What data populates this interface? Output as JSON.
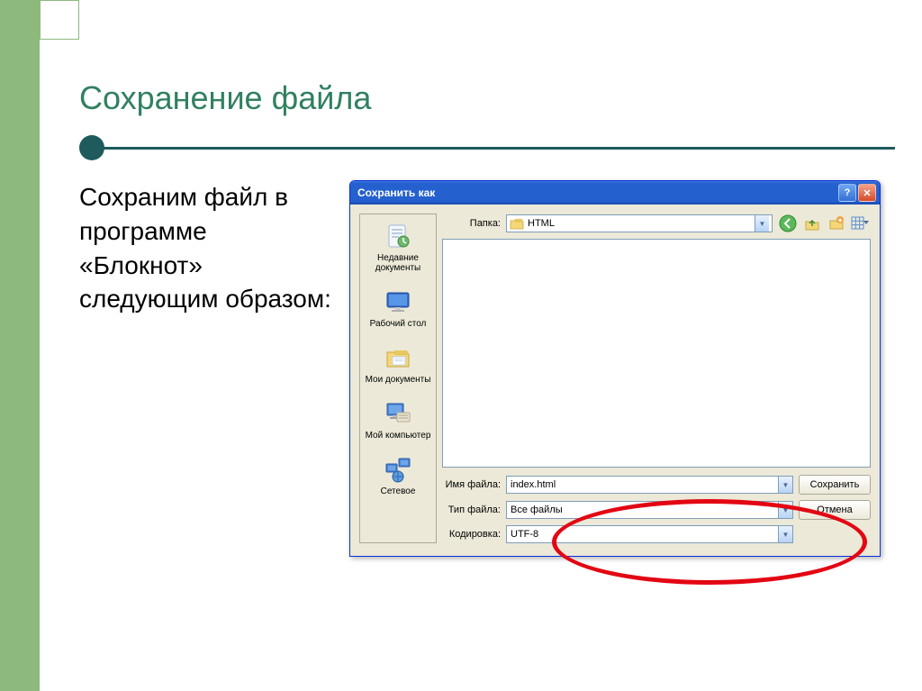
{
  "slide": {
    "title": "Сохранение файла",
    "body": "Сохраним файл в программе «Блокнот» следующим образом:"
  },
  "dialog": {
    "title": "Сохранить как",
    "folder_label": "Папка:",
    "folder_value": "HTML",
    "places": {
      "recent": "Недавние документы",
      "desktop": "Рабочий стол",
      "mydocs": "Мои документы",
      "mycomp": "Мой компьютер",
      "network": "Сетевое"
    },
    "filename_label": "Имя файла:",
    "filename_value": "index.html",
    "filetype_label": "Тип файла:",
    "filetype_value": "Все файлы",
    "encoding_label": "Кодировка:",
    "encoding_value": "UTF-8",
    "save_btn": "Сохранить",
    "cancel_btn": "Отмена"
  }
}
